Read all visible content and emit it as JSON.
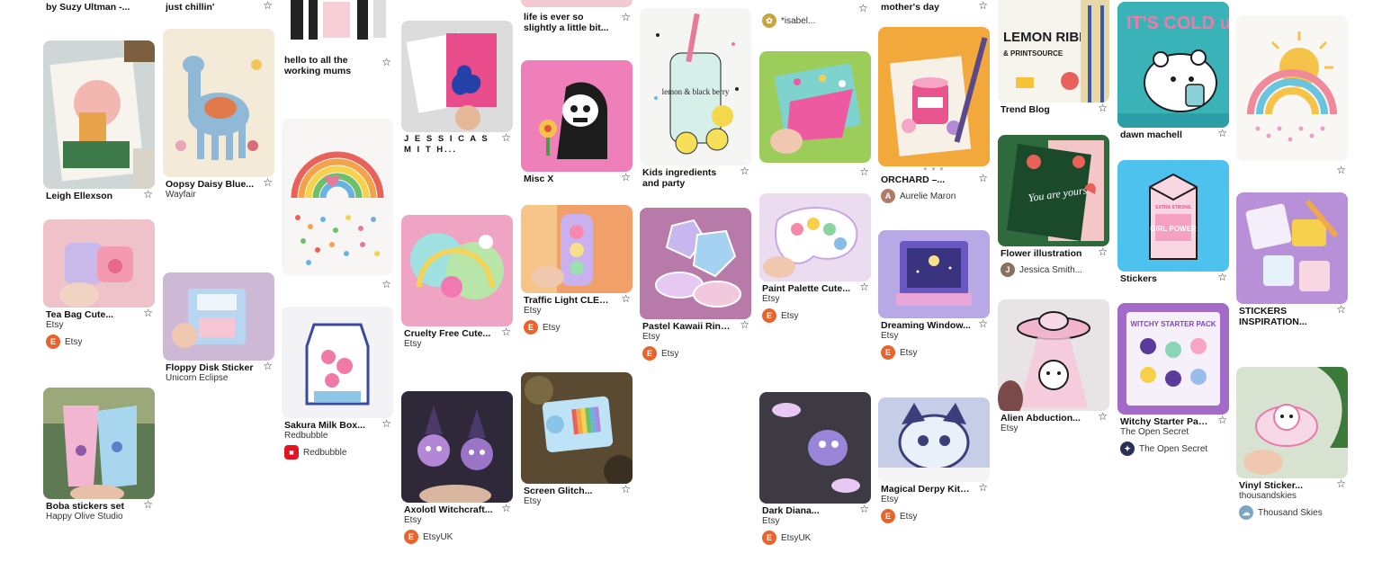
{
  "pins": {
    "c1_top": {
      "title": "by Suzy Ultman -..."
    },
    "c1_p1": {
      "title": "Leigh Ellexson"
    },
    "c1_p2": {
      "title": "Tea Bag Cute...",
      "sub": "Etsy",
      "source": "Etsy"
    },
    "c1_p3": {
      "title": "Boba stickers set",
      "sub": "Happy Olive Studio"
    },
    "c2_top": {
      "title": "just chillin'"
    },
    "c2_p1": {
      "title": "Oopsy Daisy Blue...",
      "sub": "Wayfair"
    },
    "c2_p2": {
      "title": "Floppy Disk Sticker",
      "sub": "Unicorn Eclipse"
    },
    "c3_p0": {
      "title": "hello to all the working mums wh..."
    },
    "c3_p1": {
      "title": ""
    },
    "c3_p2": {
      "title": "Sakura Milk Box...",
      "sub": "Redbubble",
      "source": "Redbubble"
    },
    "c4_p1": {
      "title": "J E S S I C A S M I T H..."
    },
    "c4_p2": {
      "title": "Cruelty Free Cute...",
      "sub": "Etsy"
    },
    "c4_p3": {
      "title": "Axolotl Witchcraft...",
      "sub": "Etsy",
      "source": "EtsyUK"
    },
    "c5_p0": {
      "title": "life is ever so slightly a little bit..."
    },
    "c5_p1": {
      "title": "Misc X"
    },
    "c5_p2": {
      "title": "Traffic Light CLEA...",
      "sub": "Etsy",
      "source": "Etsy"
    },
    "c5_p3": {
      "title": "Screen Glitch...",
      "sub": "Etsy"
    },
    "c6_p1": {
      "title": "Kids ingredients and party"
    },
    "c6_p2": {
      "title": "Pastel Kawaii Ring...",
      "sub": "Etsy",
      "source": "Etsy"
    },
    "c7_p0": {
      "source": "*isabel..."
    },
    "c7_p1": {
      "title": ""
    },
    "c7_p2": {
      "title": "Paint Palette Cute...",
      "sub": "Etsy",
      "source": "Etsy"
    },
    "c7_p3": {
      "title": "Dark Diana...",
      "sub": "Etsy",
      "source": "EtsyUK"
    },
    "c8_top": {
      "title": "mother's day"
    },
    "c8_p1": {
      "title": "ORCHARD –...",
      "source": "Aurelie Maron"
    },
    "c8_p2": {
      "title": "Dreaming Window...",
      "sub": "Etsy",
      "source": "Etsy"
    },
    "c8_p3": {
      "title": "Magical Derpy Kitt...",
      "sub": "Etsy",
      "source": "Etsy"
    },
    "c9_p1": {
      "title": "Trend Blog"
    },
    "c9_p2": {
      "title": "Flower illustration",
      "source": "Jessica Smith..."
    },
    "c9_p3": {
      "title": "Alien Abduction...",
      "sub": "Etsy"
    },
    "c10_p1": {
      "title": "dawn machell"
    },
    "c10_p2": {
      "title": "Stickers"
    },
    "c10_p3": {
      "title": "Witchy Starter Pac...",
      "sub": "The Open Secret",
      "source": "The Open Secret"
    },
    "c11_p1": {
      "title": ""
    },
    "c11_p2": {
      "title": "STICKERS INSPIRATION..."
    },
    "c11_p3": {
      "title": "Vinyl Sticker...",
      "sub": "thousandskies",
      "source": "Thousand Skies"
    }
  },
  "image_text": {
    "cold": "IT'S COLD up NORTH",
    "lemon": "LEMON RIBBON",
    "lemon_sub": "& PRINTSOURCE",
    "girl_power": "GIRL POWER",
    "extra_strong": "EXTRA STRONG",
    "witchy": "WITCHY STARTER PACK",
    "lemon_berry": "lemon & black berry",
    "you_are_yours": "You are yours"
  },
  "icons": {
    "star": "☆",
    "etsy_letter": "E"
  },
  "colors": {
    "etsy": "#e8642c",
    "redbubble": "#e41321",
    "open_secret": "#2b2f55",
    "thousand_skies": "#7aa6c2",
    "jessica": "#8a7060",
    "aurelie": "#b07c6a",
    "isabel": "#c9a33b"
  }
}
